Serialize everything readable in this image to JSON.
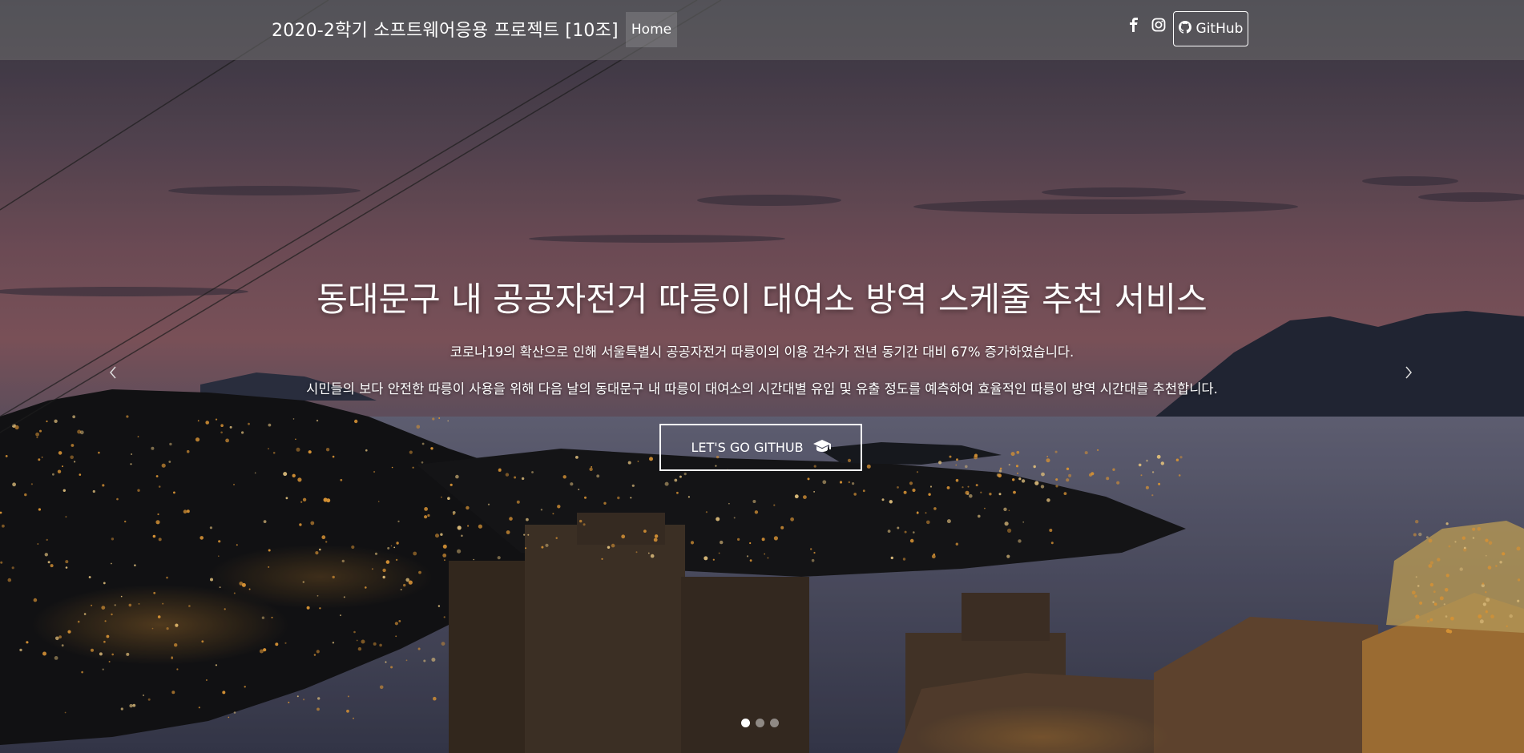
{
  "navbar": {
    "brand": "2020-2학기 소프트웨어응용 프로젝트   [10조]",
    "home": "Home",
    "facebook_icon": "facebook-icon",
    "instagram_icon": "instagram-icon",
    "github_icon": "github-icon",
    "github_label": "GitHub"
  },
  "hero": {
    "title": "동대문구 내 공공자전거 따릉이 대여소 방역 스케줄 추천 서비스",
    "line1": "코로나19의 확산으로 인해 서울특별시 공공자전거 따릉이의 이용 건수가 전년 동기간 대비 67% 증가하였습니다.",
    "line2": "시민들의 보다 안전한 따릉이 사용을 위해 다음 날의 동대문구 내 따릉이 대여소의 시간대별 유입 및 유출 정도를 예측하여 효율적인 따릉이 방역 시간대를 추천합니다.",
    "cta_label": "LET'S GO GITHUB",
    "cta_icon": "graduation-cap-icon"
  },
  "carousel": {
    "prev_icon": "chevron-left-icon",
    "next_icon": "chevron-right-icon",
    "slide_count": 3,
    "active_index": 0
  }
}
